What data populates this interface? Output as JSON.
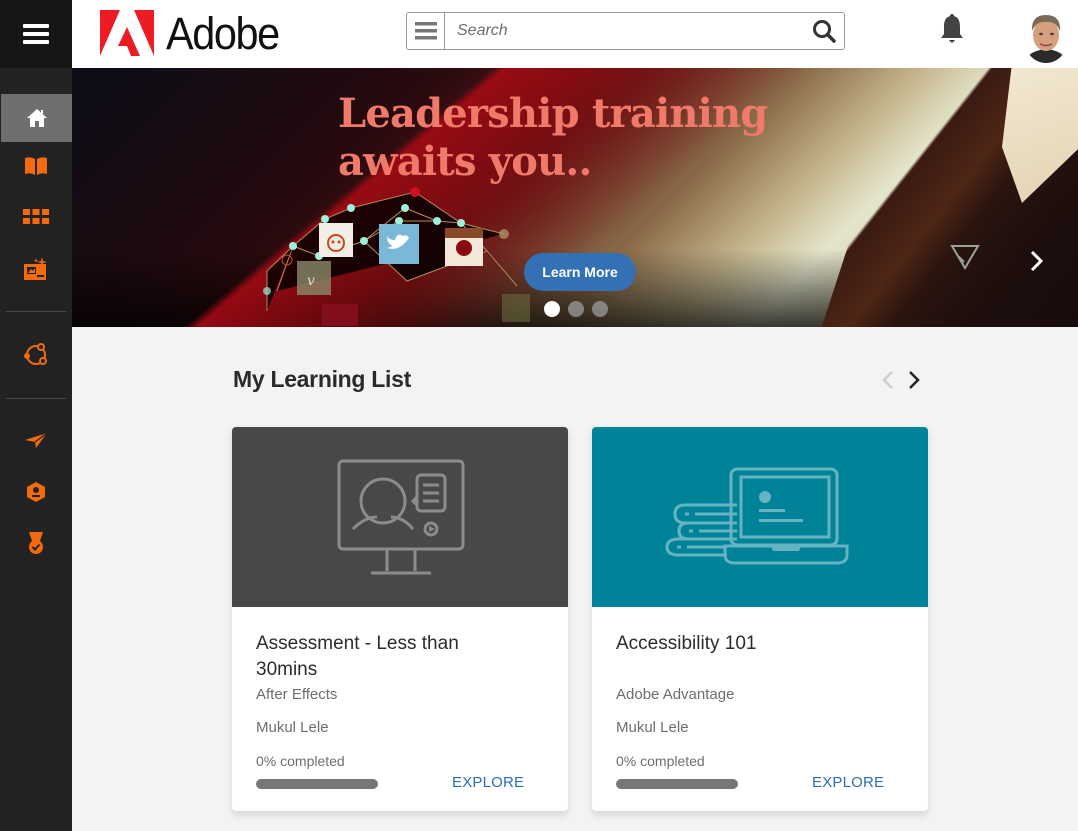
{
  "header": {
    "logo_text": "Adobe",
    "search": {
      "placeholder": "Search",
      "value": ""
    },
    "icons": [
      "menu-icon",
      "search-icon",
      "bell-icon"
    ],
    "avatar_alt": "User profile photo"
  },
  "sidebar": {
    "accent": "#f26b0f",
    "items": [
      {
        "name": "home",
        "icon": "home-icon",
        "active": true
      },
      {
        "name": "catalog",
        "icon": "book-icon",
        "active": false
      },
      {
        "name": "my-learning",
        "icon": "grid-icon",
        "active": false
      },
      {
        "name": "recommendations",
        "icon": "sparkle-image-icon",
        "active": false
      },
      {
        "name": "social",
        "icon": "social-network-icon",
        "active": false
      },
      {
        "name": "send",
        "icon": "paper-plane-icon",
        "active": false
      },
      {
        "name": "profile",
        "icon": "user-badge-icon",
        "active": false
      },
      {
        "name": "badges",
        "icon": "medal-icon",
        "active": false
      }
    ]
  },
  "banner": {
    "title_line1": "Leadership training",
    "title_line2": "awaits you..",
    "cta_label": "Learn More",
    "slides_total": 3,
    "active_slide": 1
  },
  "learning_list": {
    "title": "My Learning List",
    "cards": [
      {
        "title": "Assessment - Less than 30mins",
        "subtitle": "After Effects",
        "author": "Mukul Lele",
        "progress_label": "0% completed",
        "progress_percent": 0,
        "action_label": "EXPLORE",
        "thumb_icon": "monitor-presenter-icon",
        "thumb_color": "#484848"
      },
      {
        "title": "Accessibility 101",
        "subtitle": "Adobe Advantage",
        "author": "Mukul Lele",
        "progress_label": "0% completed",
        "progress_percent": 0,
        "action_label": "EXPLORE",
        "thumb_icon": "laptop-books-icon",
        "thumb_color": "#008299"
      }
    ]
  }
}
